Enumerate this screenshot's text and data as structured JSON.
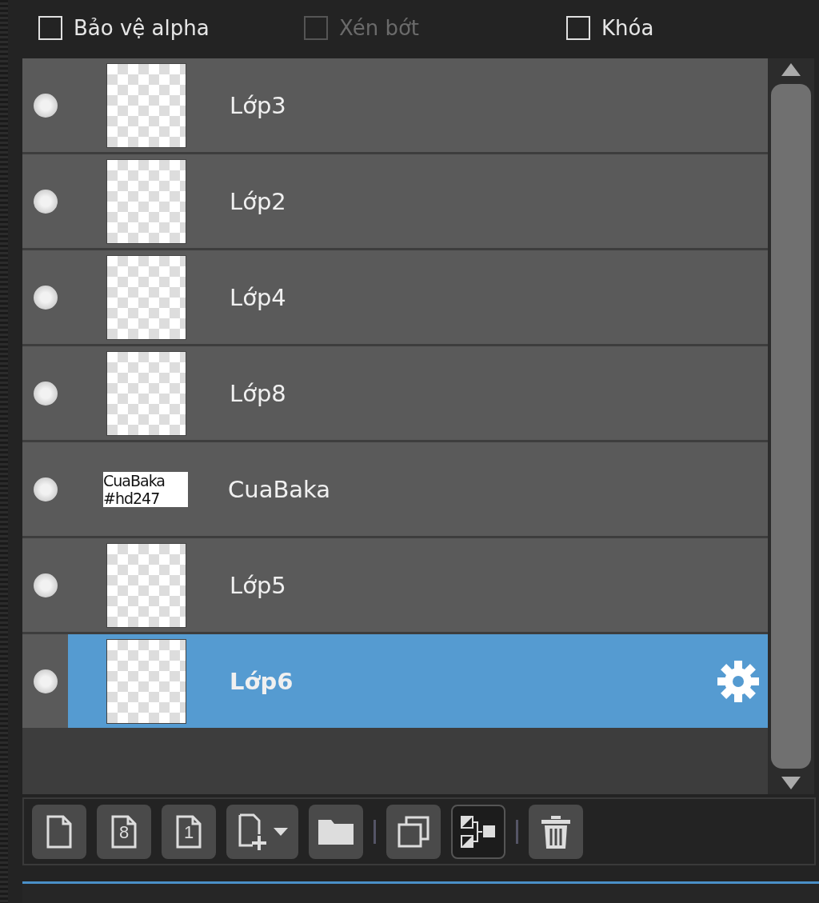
{
  "options": [
    {
      "label": "Bảo vệ alpha",
      "checked": false,
      "disabled": false
    },
    {
      "label": "Xén bớt",
      "checked": false,
      "disabled": true
    },
    {
      "label": "Khóa",
      "checked": false,
      "disabled": false
    }
  ],
  "layers": [
    {
      "name": "Lớp3",
      "visible": true,
      "selected": false,
      "kind": "checker"
    },
    {
      "name": "Lớp2",
      "visible": true,
      "selected": false,
      "kind": "checker"
    },
    {
      "name": "Lớp4",
      "visible": true,
      "selected": false,
      "kind": "checker"
    },
    {
      "name": "Lớp8",
      "visible": true,
      "selected": false,
      "kind": "checker"
    },
    {
      "name": "CuaBaka",
      "visible": true,
      "selected": false,
      "kind": "text",
      "thumb_text": [
        "CuaBaka",
        "#hd247"
      ]
    },
    {
      "name": "Lớp5",
      "visible": true,
      "selected": false,
      "kind": "checker"
    },
    {
      "name": "Lớp6",
      "visible": true,
      "selected": true,
      "kind": "checker"
    }
  ],
  "toolbar": [
    {
      "kind": "new"
    },
    {
      "kind": "new8",
      "glyph": "8"
    },
    {
      "kind": "new1",
      "glyph": "1"
    },
    {
      "kind": "add-menu"
    },
    {
      "kind": "folder"
    },
    {
      "kind": "sep"
    },
    {
      "kind": "duplicate"
    },
    {
      "kind": "merge",
      "selected": true
    },
    {
      "kind": "sep"
    },
    {
      "kind": "delete"
    }
  ]
}
